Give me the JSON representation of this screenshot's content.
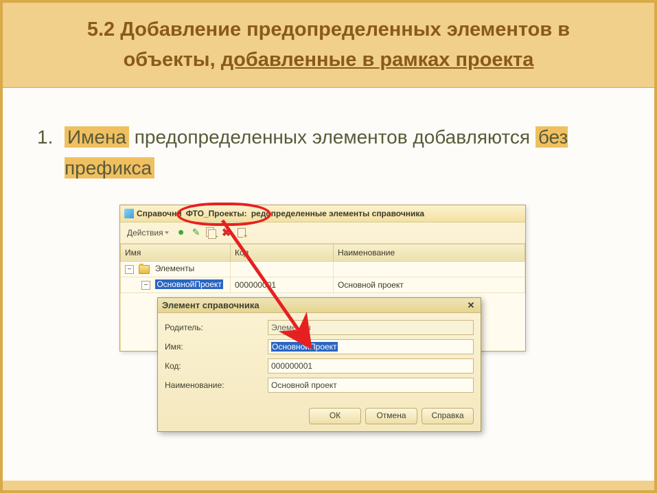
{
  "header": {
    "line1": "5.2 Добавление предопределенных элементов в",
    "line2_before": "объекты, ",
    "line2_underline": "добавленные в рамках проекта"
  },
  "bullet": {
    "number": "1.",
    "hl1": "Имена",
    "text_mid": " предопределенных элементов добавляются ",
    "hl2": "без префикса"
  },
  "win1": {
    "title_prefix": "Справочни",
    "title_emph": "ФТО_Проекты:",
    "title_suffix": "редопределенные элементы справочника",
    "actions_menu": "Действия",
    "columns": {
      "name": "Имя",
      "code": "Код",
      "display": "Наименование"
    },
    "rows": {
      "parent": "Элементы",
      "child_name": "ОсновнойПроект",
      "child_code": "000000001",
      "child_display": "Основной проект"
    }
  },
  "dialog": {
    "title": "Элемент справочника",
    "labels": {
      "parent": "Родитель:",
      "name": "Имя:",
      "code": "Код:",
      "display": "Наименование:"
    },
    "values": {
      "parent": "Элементы",
      "name": "ОсновнойПроект",
      "code": "000000001",
      "display": "Основной проект"
    },
    "buttons": {
      "ok": "ОК",
      "cancel": "Отмена",
      "help": "Справка"
    }
  }
}
